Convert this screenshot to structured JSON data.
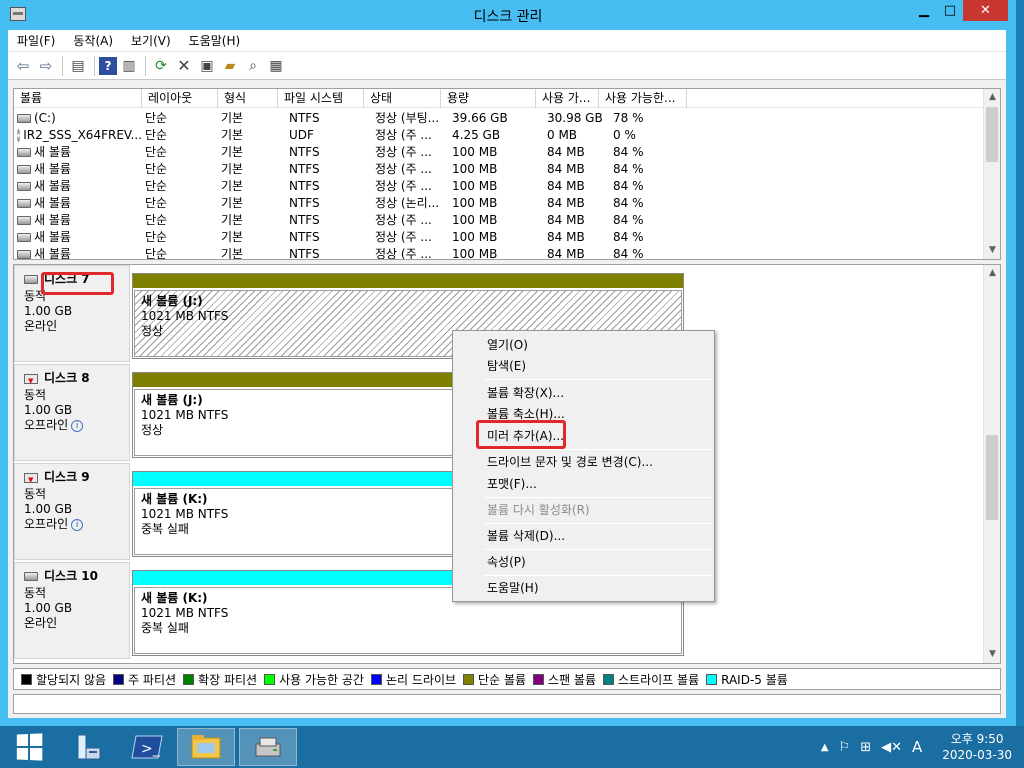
{
  "window": {
    "title": "디스크 관리"
  },
  "menu": [
    "파일(F)",
    "동작(A)",
    "보기(V)",
    "도움말(H)"
  ],
  "volume_table": {
    "headers": [
      "볼륨",
      "레이아웃",
      "형식",
      "파일 시스템",
      "상태",
      "용량",
      "사용 가...",
      "사용 가능한..."
    ],
    "rows": [
      [
        "(C:)",
        "단순",
        "기본",
        "NTFS",
        "정상 (부팅...",
        "39.66 GB",
        "30.98 GB",
        "78 %"
      ],
      [
        "IR2_SSS_X64FREV...",
        "단순",
        "기본",
        "UDF",
        "정상 (주 ...",
        "4.25 GB",
        "0 MB",
        "0 %"
      ],
      [
        "새 볼륨",
        "단순",
        "기본",
        "NTFS",
        "정상 (주 ...",
        "100 MB",
        "84 MB",
        "84 %"
      ],
      [
        "새 볼륨",
        "단순",
        "기본",
        "NTFS",
        "정상 (주 ...",
        "100 MB",
        "84 MB",
        "84 %"
      ],
      [
        "새 볼륨",
        "단순",
        "기본",
        "NTFS",
        "정상 (주 ...",
        "100 MB",
        "84 MB",
        "84 %"
      ],
      [
        "새 볼륨",
        "단순",
        "기본",
        "NTFS",
        "정상 (논리...",
        "100 MB",
        "84 MB",
        "84 %"
      ],
      [
        "새 볼륨",
        "단순",
        "기본",
        "NTFS",
        "정상 (주 ...",
        "100 MB",
        "84 MB",
        "84 %"
      ],
      [
        "새 볼륨",
        "단순",
        "기본",
        "NTFS",
        "정상 (주 ...",
        "100 MB",
        "84 MB",
        "84 %"
      ],
      [
        "새 볼륨",
        "단순",
        "기본",
        "NTFS",
        "정상 (주 ...",
        "100 MB",
        "84 MB",
        "84 %"
      ]
    ]
  },
  "disks": [
    {
      "name": "디스크 7",
      "type": "동적",
      "size": "1.00 GB",
      "status": "온라인",
      "status_info": false,
      "bar_color": "#808000",
      "part_name": "새 볼륨  (J:)",
      "part_size": "1021 MB NTFS",
      "part_status": "정상",
      "hatched": true
    },
    {
      "name": "디스크 8",
      "type": "동적",
      "size": "1.00 GB",
      "status": "오프라인",
      "status_info": true,
      "bar_color": "#808000",
      "part_name": "새 볼륨  (J:)",
      "part_size": "1021 MB NTFS",
      "part_status": "정상",
      "hatched": false
    },
    {
      "name": "디스크 9",
      "type": "동적",
      "size": "1.00 GB",
      "status": "오프라인",
      "status_info": true,
      "bar_color": "#00ffff",
      "part_name": "새 볼륨  (K:)",
      "part_size": "1021 MB NTFS",
      "part_status": "중복 실패",
      "hatched": false
    },
    {
      "name": "디스크 10",
      "type": "동적",
      "size": "1.00 GB",
      "status": "온라인",
      "status_info": false,
      "bar_color": "#00ffff",
      "part_name": "새 볼륨  (K:)",
      "part_size": "1021 MB NTFS",
      "part_status": "중복 실패",
      "hatched": false
    }
  ],
  "context_menu": {
    "items": [
      {
        "label": "열기(O)",
        "disabled": false
      },
      {
        "label": "탐색(E)",
        "disabled": false
      },
      {
        "label": "볼륨 확장(X)...",
        "disabled": false
      },
      {
        "label": "볼륨 축소(H)...",
        "disabled": false
      },
      {
        "label": "미러 추가(A)...",
        "disabled": false
      },
      {
        "label": "드라이브 문자 및 경로 변경(C)...",
        "disabled": false
      },
      {
        "label": "포맷(F)...",
        "disabled": false
      },
      {
        "label": "볼륨 다시 활성화(R)",
        "disabled": true
      },
      {
        "label": "볼륨 삭제(D)...",
        "disabled": false
      },
      {
        "label": "속성(P)",
        "disabled": false
      },
      {
        "label": "도움말(H)",
        "disabled": false
      }
    ]
  },
  "legend": [
    {
      "label": "할당되지 않음",
      "color": "#000000"
    },
    {
      "label": "주 파티션",
      "color": "#000080"
    },
    {
      "label": "확장 파티션",
      "color": "#008000"
    },
    {
      "label": "사용 가능한 공간",
      "color": "#00ff00"
    },
    {
      "label": "논리 드라이브",
      "color": "#0000ff"
    },
    {
      "label": "단순 볼륨",
      "color": "#808000"
    },
    {
      "label": "스팬 볼륨",
      "color": "#800080"
    },
    {
      "label": "스트라이프 볼륨",
      "color": "#008080"
    },
    {
      "label": "RAID-5 볼륨",
      "color": "#00ffff"
    }
  ],
  "taskbar": {
    "clock_time": "오후 9:50",
    "clock_date": "2020-03-30",
    "ime": "A"
  }
}
